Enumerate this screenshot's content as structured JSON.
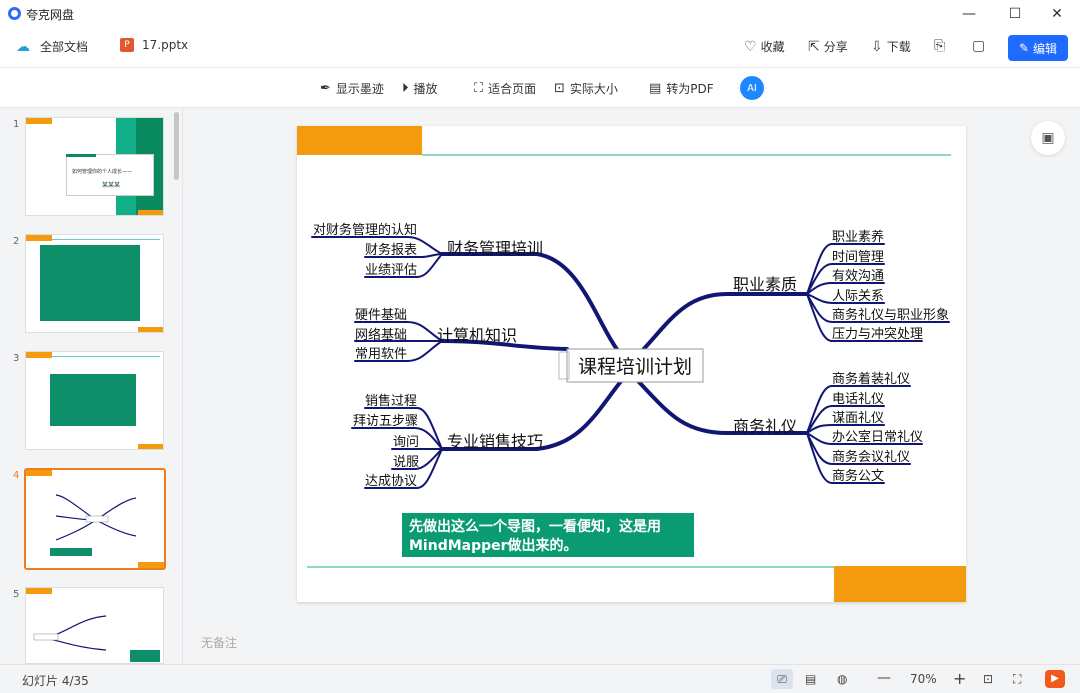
{
  "app": {
    "title": "夸克网盘"
  },
  "window": {
    "minimize": "—",
    "maximize": "☐",
    "close": "✕"
  },
  "toolbar": {
    "all_docs": "全部文档",
    "file_name": "17.pptx",
    "favorite": "收藏",
    "share": "分享",
    "download": "下载",
    "edit": "编辑"
  },
  "viewer_tools": {
    "show_ink": "显示墨迹",
    "play": "播放",
    "fit_page": "适合页面",
    "actual_size": "实际大小",
    "to_pdf": "转为PDF",
    "ai_label": "AI"
  },
  "thumbnails": [
    {
      "num": "1",
      "caption": "如何管理你的个人成长——",
      "subtitle": "某某某"
    },
    {
      "num": "2"
    },
    {
      "num": "3"
    },
    {
      "num": "4",
      "active": true
    },
    {
      "num": "5"
    }
  ],
  "slide": {
    "center": "课程培训计划",
    "branches": {
      "finance": {
        "title": "财务管理培训",
        "items": [
          "对财务管理的认知",
          "财务报表",
          "业绩评估"
        ]
      },
      "computer": {
        "title": "计算机知识",
        "items": [
          "硬件基础",
          "网络基础",
          "常用软件"
        ]
      },
      "sales": {
        "title": "专业销售技巧",
        "items": [
          "销售过程",
          "拜访五步骤",
          "询问",
          "说服",
          "达成协议"
        ]
      },
      "career": {
        "title": "职业素质",
        "items": [
          "职业素养",
          "时间管理",
          "有效沟通",
          "人际关系",
          "商务礼仪与职业形象",
          "压力与冲突处理"
        ]
      },
      "etiquette": {
        "title": "商务礼仪",
        "items": [
          "商务着装礼仪",
          "电话礼仪",
          "谋面礼仪",
          "办公室日常礼仪",
          "商务会议礼仪",
          "商务公文"
        ]
      }
    },
    "note_line1": "先做出这么一个导图，一看便知，这是用",
    "note_line2": "MindMapper做出来的。"
  },
  "notes_placeholder": "无备注",
  "status": {
    "slide_counter": "幻灯片 4/35",
    "zoom": "70%"
  },
  "colors": {
    "accent_orange": "#f39a0e",
    "teal": "#0a9b73",
    "navy": "#101672",
    "edit_blue": "#1f6bff"
  }
}
